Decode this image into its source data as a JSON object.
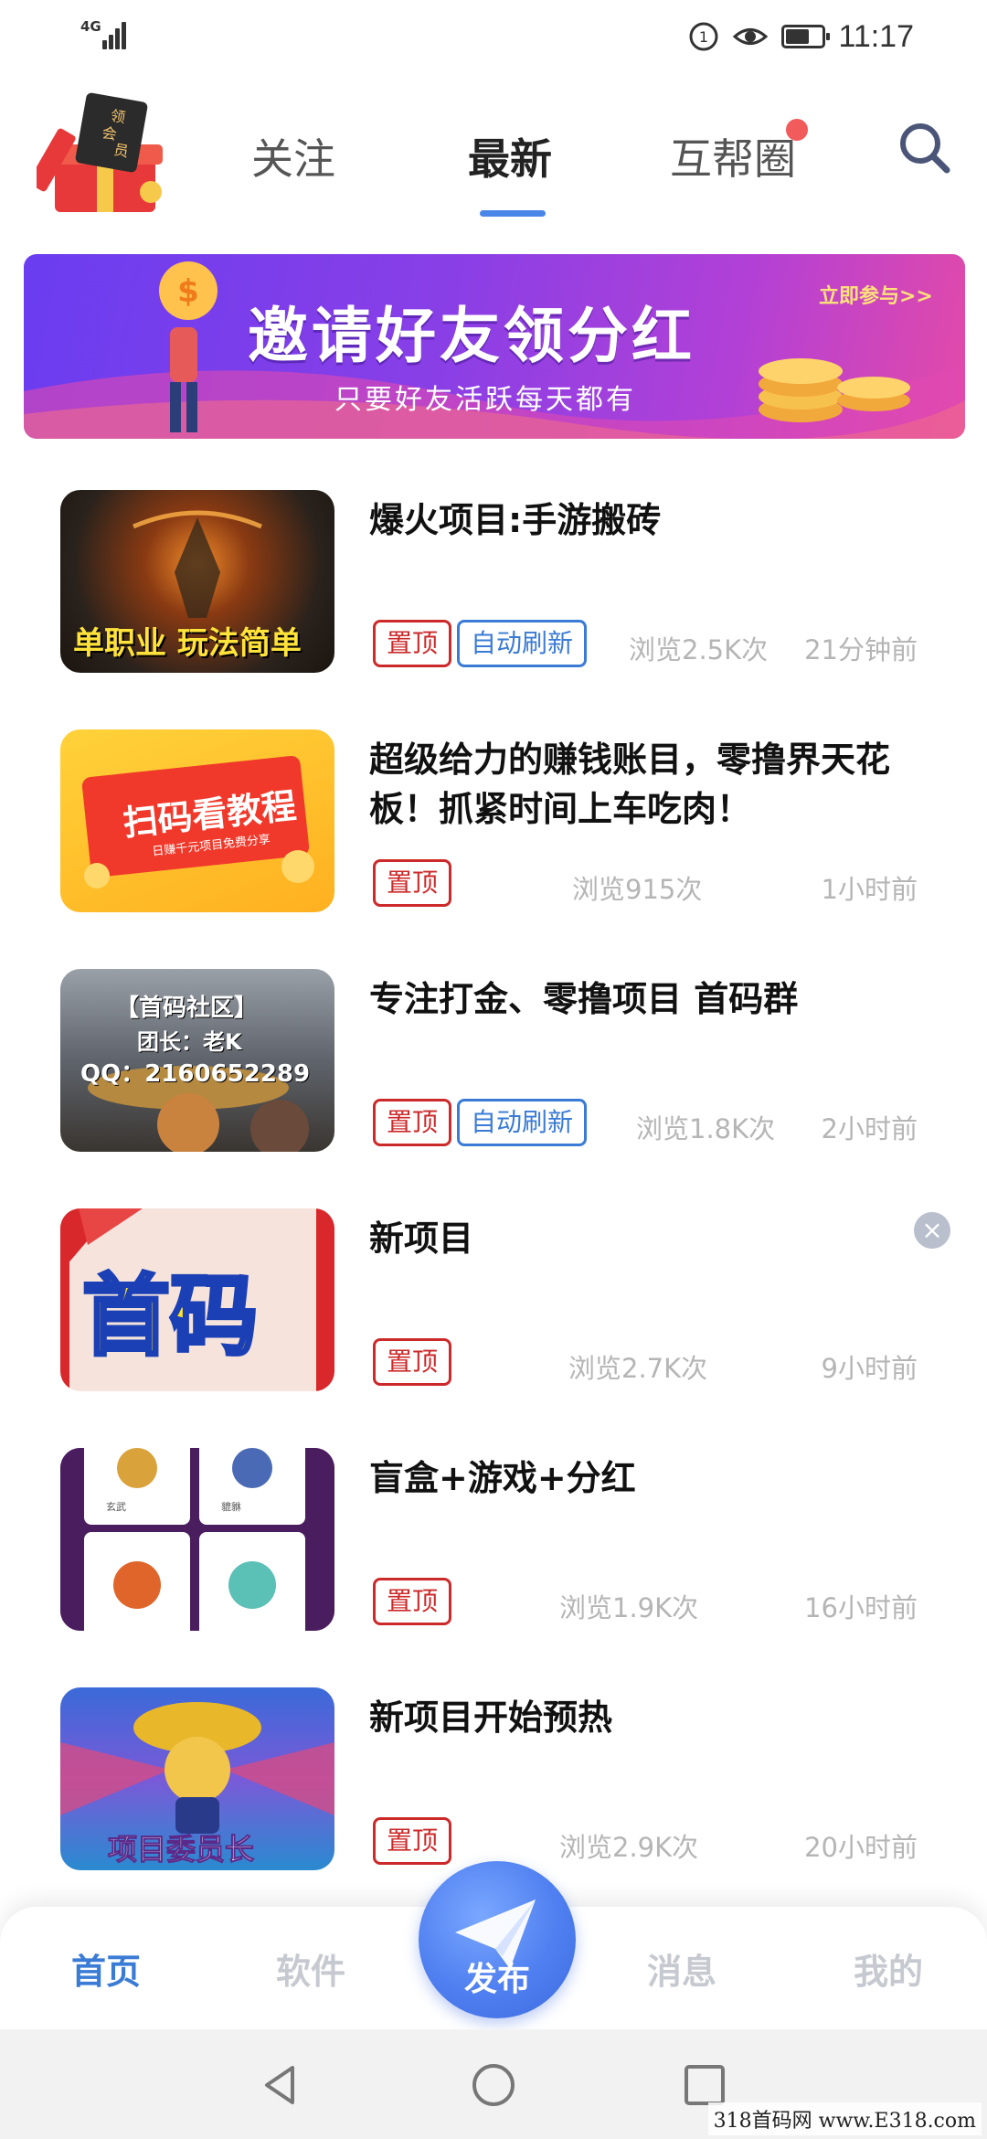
{
  "status_bar": {
    "network": "4G",
    "time": "11:17",
    "battery_level": 0.65
  },
  "header": {
    "vip_badge": "领会员",
    "tabs": [
      {
        "label": "关注",
        "active": false
      },
      {
        "label": "最新",
        "active": true
      },
      {
        "label": "互帮圈",
        "active": false,
        "has_dot": true
      }
    ],
    "search_icon": "search-icon"
  },
  "banner": {
    "title": "邀请好友领分红",
    "subtitle": "只要好友活跃每天都有",
    "cta": "立即参与>>"
  },
  "feed": [
    {
      "title": "爆火项目:手游搬砖",
      "tags": [
        "置顶",
        "自动刷新"
      ],
      "views": "浏览2.5K次",
      "time": "21分钟前",
      "thumb_text": "单职业 玩法简单"
    },
    {
      "title": "超级给力的赚钱账目，零撸界天花板！抓紧时间上车吃肉！",
      "tags": [
        "置顶"
      ],
      "views": "浏览915次",
      "time": "1小时前",
      "thumb_text": "扫码看教程",
      "thumb_sub": "日赚千元项目免费分享"
    },
    {
      "title": "专注打金、零撸项目 首码群",
      "tags": [
        "置顶",
        "自动刷新"
      ],
      "views": "浏览1.8K次",
      "time": "2小时前",
      "thumb_lines": [
        "【首码社区】",
        "团长：老K",
        "QQ：2160652289"
      ]
    },
    {
      "title": "新项目",
      "tags": [
        "置顶"
      ],
      "views": "浏览2.7K次",
      "time": "9小时前",
      "thumb_text": "首码",
      "closable": true
    },
    {
      "title": "盲盒+游戏+分红",
      "tags": [
        "置顶"
      ],
      "views": "浏览1.9K次",
      "time": "16小时前",
      "thumb_labels": [
        "玄武",
        "貔貅"
      ]
    },
    {
      "title": "新项目开始预热",
      "tags": [
        "置顶"
      ],
      "views": "浏览2.9K次",
      "time": "20小时前",
      "thumb_text": "项目委员长"
    }
  ],
  "bottom_nav": {
    "items": [
      {
        "label": "首页",
        "active": true
      },
      {
        "label": "软件",
        "active": false
      },
      {
        "label": "消息",
        "active": false
      },
      {
        "label": "我的",
        "active": false
      }
    ],
    "publish": "发布"
  },
  "watermark": "318首码网 www.E318.com",
  "colors": {
    "accent": "#3a7bd5",
    "pin_red": "#cc2a2a",
    "banner_purple": "#7a3fe8"
  }
}
